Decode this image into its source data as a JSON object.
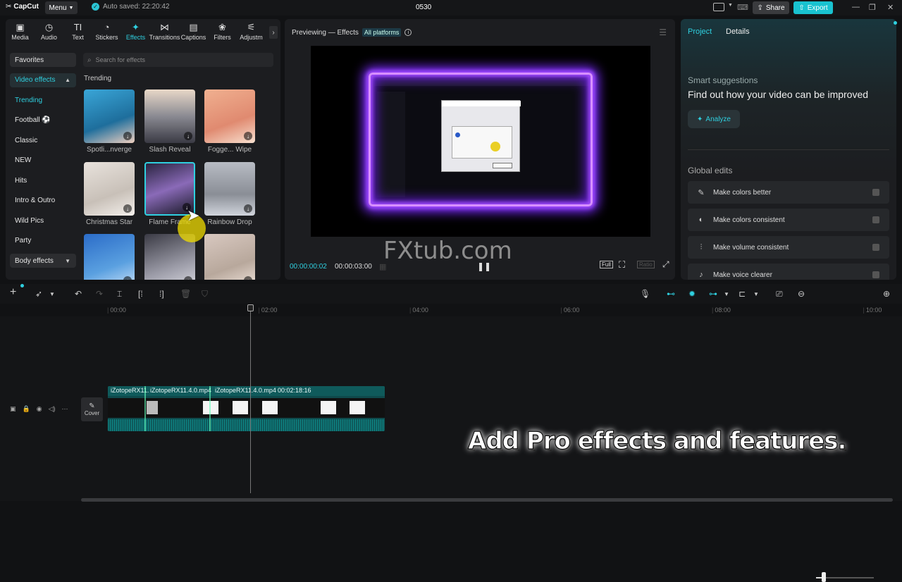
{
  "app": {
    "name": "CapCut",
    "menu_label": "Menu",
    "autosave": "Auto saved: 22:20:42",
    "project_name": "0530",
    "share_label": "Share",
    "export_label": "Export"
  },
  "left_tabs": [
    {
      "label": "Media",
      "icon": "media-icon",
      "glyph": "▣"
    },
    {
      "label": "Audio",
      "icon": "audio-icon",
      "glyph": "◷"
    },
    {
      "label": "Text",
      "icon": "text-icon",
      "glyph": "TI"
    },
    {
      "label": "Stickers",
      "icon": "stickers-icon",
      "glyph": "◔"
    },
    {
      "label": "Effects",
      "icon": "effects-icon",
      "glyph": "✦"
    },
    {
      "label": "Transitions",
      "icon": "transitions-icon",
      "glyph": "⋈"
    },
    {
      "label": "Captions",
      "icon": "captions-icon",
      "glyph": "▤"
    },
    {
      "label": "Filters",
      "icon": "filters-icon",
      "glyph": "❀"
    },
    {
      "label": "Adjustm",
      "icon": "adjust-icon",
      "glyph": "⚟"
    }
  ],
  "categories": [
    {
      "label": "Favorites",
      "style": "box"
    },
    {
      "label": "Video effects",
      "style": "sel"
    },
    {
      "label": "Trending",
      "style": "teal"
    },
    {
      "label": "Football ⚽",
      "style": ""
    },
    {
      "label": "Classic",
      "style": ""
    },
    {
      "label": "NEW",
      "style": ""
    },
    {
      "label": "Hits",
      "style": ""
    },
    {
      "label": "Intro & Outro",
      "style": ""
    },
    {
      "label": "Wild Pics",
      "style": ""
    },
    {
      "label": "Party",
      "style": ""
    },
    {
      "label": "Body effects",
      "style": "box"
    }
  ],
  "search_placeholder": "Search for effects",
  "section_title": "Trending",
  "effects": [
    {
      "label": "Spotli...nverge",
      "bg": "linear-gradient(160deg,#3aa6d8,#1e6e9c 60%,#f0d0c0)"
    },
    {
      "label": "Slash Reveal",
      "bg": "linear-gradient(180deg,#e8d8c8,#8a8a92 50%,#3a3a44)"
    },
    {
      "label": "Fogge... Wipe",
      "bg": "linear-gradient(160deg,#f0b090,#e08a70 60%,#f8e0d0)"
    },
    {
      "label": "Christmas Star",
      "bg": "linear-gradient(160deg,#e8e2dc,#c8c0b8 60%,#f4f0ec)"
    },
    {
      "label": "Flame Frame",
      "bg": "linear-gradient(160deg,#2a2440,#8a6ab8 50%,#1a1a28)"
    },
    {
      "label": "Rainbow Drop",
      "bg": "linear-gradient(180deg,#b8bcc4,#8a8e96 60%,#d0d4dc)"
    },
    {
      "label": "",
      "bg": "linear-gradient(160deg,#2b6cc8,#5aa0e0 60%,#c8e0f8)"
    },
    {
      "label": "",
      "bg": "linear-gradient(160deg,#3a3a44,#9a9aa6 60%,#d8d8e0)"
    },
    {
      "label": "",
      "bg": "linear-gradient(160deg,#d8c8c0,#b8a89c 60%,#f0e4dc)"
    }
  ],
  "preview": {
    "title": "Previewing — Effects",
    "badge": "All platforms",
    "watermark": "FXtub.com",
    "current_time": "00:00:00:02",
    "total_time": "00:00:03:00",
    "full_label": "Full",
    "ratio_label": "Ratio"
  },
  "right": {
    "tab_project": "Project",
    "tab_details": "Details",
    "sugg_heading": "Smart suggestions",
    "sugg_text": "Find out how your video can be improved",
    "analyze": "Analyze",
    "global_heading": "Global edits",
    "items": [
      {
        "label": "Make colors better",
        "glyph": "✎"
      },
      {
        "label": "Make colors consistent",
        "glyph": "◐"
      },
      {
        "label": "Make volume consistent",
        "glyph": "⫶"
      },
      {
        "label": "Make voice clearer",
        "glyph": "♪"
      }
    ]
  },
  "ruler": [
    "00:00",
    "02:00",
    "04:00",
    "06:00",
    "08:00",
    "10:00"
  ],
  "clip": {
    "names": [
      "iZotopeRX11.",
      "iZotopeRX11.4.0.mp4",
      "iZotopeRX11.4.0.mp4"
    ],
    "duration": "00:02:18:16"
  },
  "cover_label": "Cover",
  "overlay_caption": "Add Pro effects and features.",
  "colors": {
    "accent": "#2fd0e0",
    "export": "#19c2d0",
    "flame": "#a24cff"
  }
}
